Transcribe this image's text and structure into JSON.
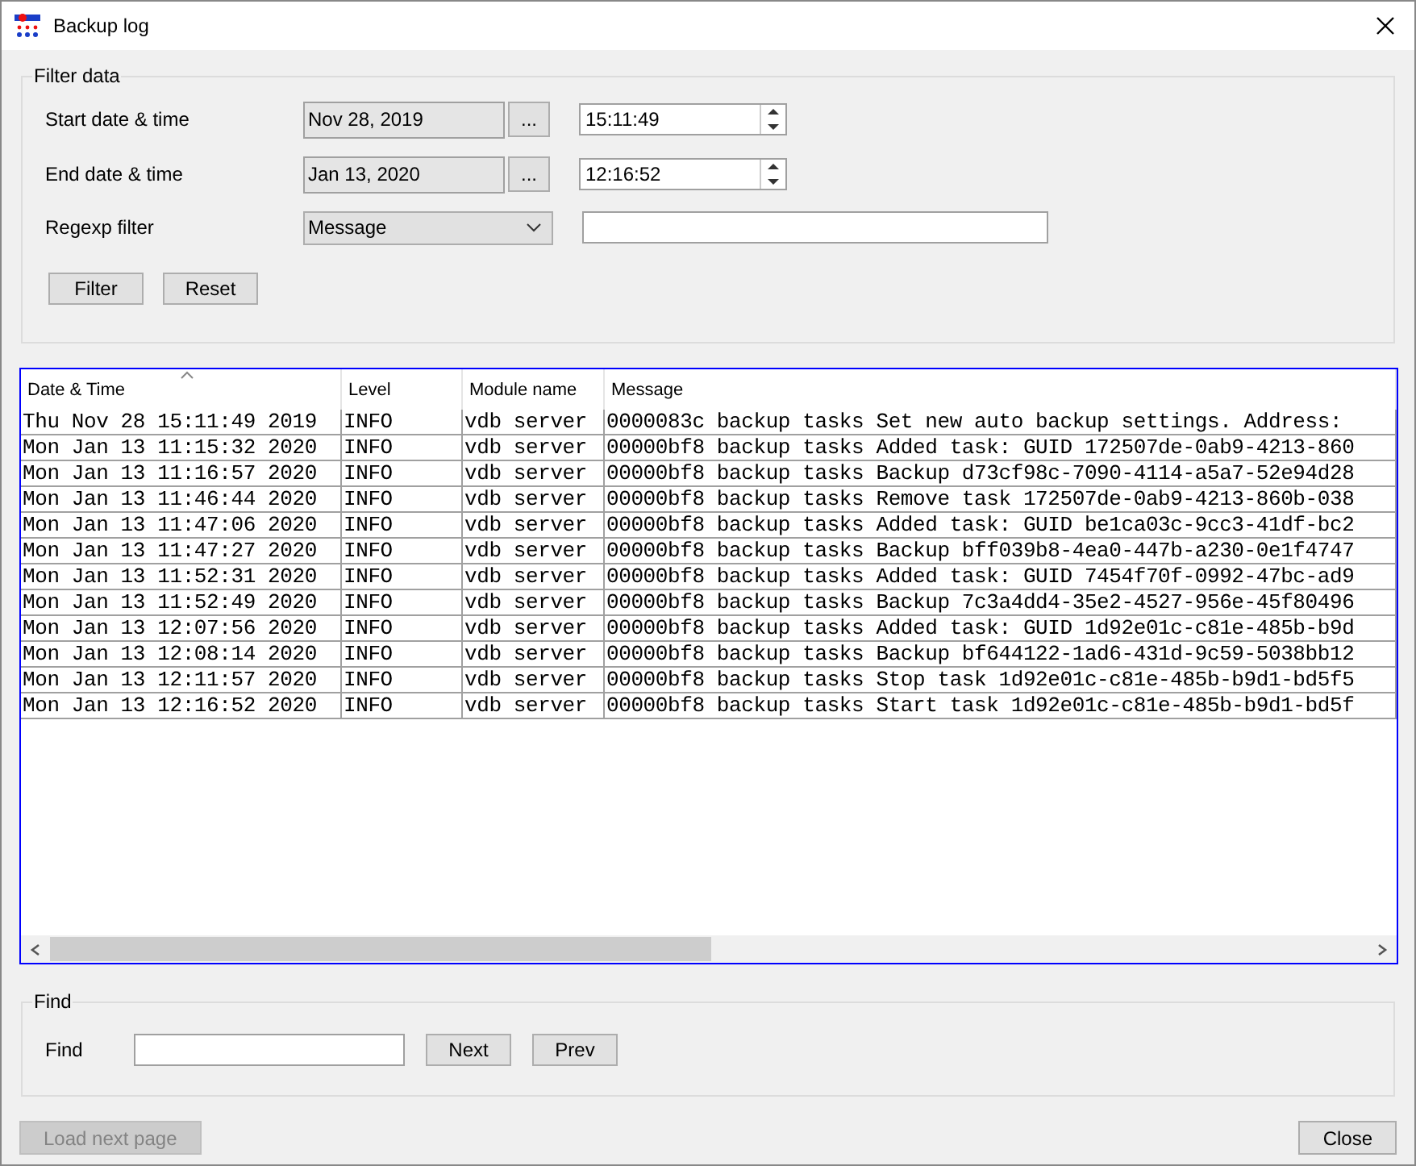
{
  "window": {
    "title": "Backup log"
  },
  "filter": {
    "title": "Filter data",
    "ranges": [
      {
        "label": "Start date & time",
        "date": "Nov 28, 2019",
        "picker": "...",
        "time": "15:11:49"
      },
      {
        "label": "End date & time",
        "date": "Jan 13, 2020",
        "picker": "...",
        "time": "12:16:52"
      }
    ],
    "regexp": {
      "label": "Regexp filter",
      "field": "Message"
    },
    "buttons": [
      "Filter",
      "Reset"
    ]
  },
  "table": {
    "columns": [
      {
        "label": "Date & Time",
        "sorted": true
      },
      {
        "label": "Level",
        "sorted": false
      },
      {
        "label": "Module name",
        "sorted": false
      },
      {
        "label": "Message",
        "sorted": false
      }
    ],
    "rows": [
      {
        "date": "Thu Nov 28 15:11:49 2019",
        "level": "INFO",
        "module": "vdb server",
        "message": "0000083c backup tasks Set new auto backup settings. Address:"
      },
      {
        "date": "Mon Jan 13 11:15:32 2020",
        "level": "INFO",
        "module": "vdb server",
        "message": "00000bf8 backup tasks Added task: GUID 172507de-0ab9-4213-860"
      },
      {
        "date": "Mon Jan 13 11:16:57 2020",
        "level": "INFO",
        "module": "vdb server",
        "message": "00000bf8 backup tasks Backup d73cf98c-7090-4114-a5a7-52e94d28"
      },
      {
        "date": "Mon Jan 13 11:46:44 2020",
        "level": "INFO",
        "module": "vdb server",
        "message": "00000bf8 backup tasks Remove task 172507de-0ab9-4213-860b-038"
      },
      {
        "date": "Mon Jan 13 11:47:06 2020",
        "level": "INFO",
        "module": "vdb server",
        "message": "00000bf8 backup tasks Added task: GUID be1ca03c-9cc3-41df-bc2"
      },
      {
        "date": "Mon Jan 13 11:47:27 2020",
        "level": "INFO",
        "module": "vdb server",
        "message": "00000bf8 backup tasks Backup bff039b8-4ea0-447b-a230-0e1f4747"
      },
      {
        "date": "Mon Jan 13 11:52:31 2020",
        "level": "INFO",
        "module": "vdb server",
        "message": "00000bf8 backup tasks Added task: GUID 7454f70f-0992-47bc-ad9"
      },
      {
        "date": "Mon Jan 13 11:52:49 2020",
        "level": "INFO",
        "module": "vdb server",
        "message": "00000bf8 backup tasks Backup 7c3a4dd4-35e2-4527-956e-45f80496"
      },
      {
        "date": "Mon Jan 13 12:07:56 2020",
        "level": "INFO",
        "module": "vdb server",
        "message": "00000bf8 backup tasks Added task: GUID 1d92e01c-c81e-485b-b9d"
      },
      {
        "date": "Mon Jan 13 12:08:14 2020",
        "level": "INFO",
        "module": "vdb server",
        "message": "00000bf8 backup tasks Backup bf644122-1ad6-431d-9c59-5038bb12"
      },
      {
        "date": "Mon Jan 13 12:11:57 2020",
        "level": "INFO",
        "module": "vdb server",
        "message": "00000bf8 backup tasks Stop task 1d92e01c-c81e-485b-b9d1-bd5f5"
      },
      {
        "date": "Mon Jan 13 12:16:52 2020",
        "level": "INFO",
        "module": "vdb server",
        "message": "00000bf8 backup tasks Start task 1d92e01c-c81e-485b-b9d1-bd5f"
      }
    ]
  },
  "find": {
    "title": "Find",
    "label": "Find",
    "buttons": [
      "Next",
      "Prev"
    ]
  },
  "footer": [
    {
      "label": "Load next page",
      "disabled": true
    },
    {
      "label": "Close",
      "disabled": false
    }
  ]
}
